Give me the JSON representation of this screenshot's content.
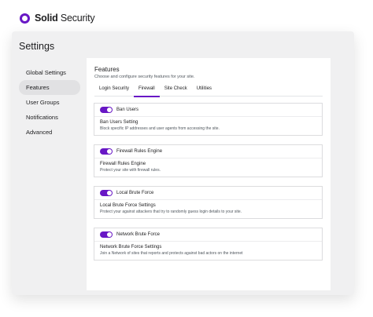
{
  "brand": {
    "name_bold": "Solid",
    "name_rest": " Security"
  },
  "page": {
    "title": "Settings"
  },
  "nav": {
    "items": [
      {
        "label": "Global Settings",
        "active": false
      },
      {
        "label": "Features",
        "active": true
      },
      {
        "label": "User Groups",
        "active": false
      },
      {
        "label": "Notifications",
        "active": false
      },
      {
        "label": "Advanced",
        "active": false
      }
    ]
  },
  "panel": {
    "title": "Features",
    "subtitle": "Choose and configure security features for your site.",
    "tabs": [
      {
        "label": "Login Security",
        "active": false
      },
      {
        "label": "Firewall",
        "active": true
      },
      {
        "label": "Site Check",
        "active": false
      },
      {
        "label": "Utilities",
        "active": false
      }
    ],
    "features": [
      {
        "toggle_label": "Ban Users",
        "enabled": true,
        "title": "Ban Users Setting",
        "description": "Block specific IP addresses and user agents from accessing the site."
      },
      {
        "toggle_label": "Firewall Rules Engine",
        "enabled": true,
        "title": "Firewall Rules Engine",
        "description": "Protect your site with firewall rules."
      },
      {
        "toggle_label": "Local Brute Force",
        "enabled": true,
        "title": "Local Brute Force Settings",
        "description": "Protect your against attackers that try to randomly guess login details to your site."
      },
      {
        "toggle_label": "Network Brute Force",
        "enabled": true,
        "title": "Network Brute Force Settings",
        "description": "Join a Network of sites that reports and protects against bad actors on the internet"
      }
    ]
  },
  "colors": {
    "accent": "#6817c5",
    "window_bg": "#f0f0f1",
    "active_nav_bg": "#e1e1e3"
  },
  "icons": {
    "brand_logo": "shield-logo-icon"
  }
}
